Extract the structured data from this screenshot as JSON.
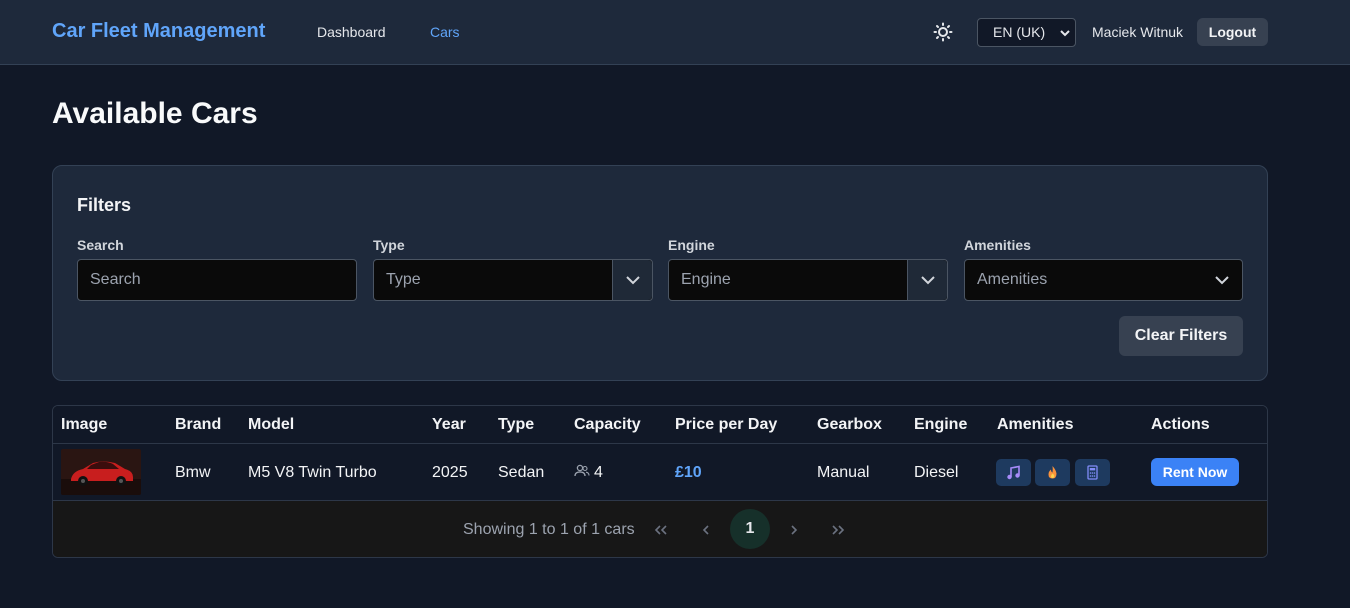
{
  "header": {
    "brand": "Car Fleet Management",
    "nav": [
      {
        "label": "Dashboard",
        "active": false
      },
      {
        "label": "Cars",
        "active": true
      }
    ],
    "theme_icon": "sun-icon",
    "language": "EN (UK)",
    "user_name": "Maciek Witnuk",
    "logout_label": "Logout"
  },
  "page_title": "Available Cars",
  "filters": {
    "title": "Filters",
    "search": {
      "label": "Search",
      "placeholder": "Search"
    },
    "type": {
      "label": "Type",
      "placeholder": "Type"
    },
    "engine": {
      "label": "Engine",
      "placeholder": "Engine"
    },
    "amenities": {
      "label": "Amenities",
      "placeholder": "Amenities"
    },
    "clear_label": "Clear Filters"
  },
  "table": {
    "columns": [
      "Image",
      "Brand",
      "Model",
      "Year",
      "Type",
      "Capacity",
      "Price per Day",
      "Gearbox",
      "Engine",
      "Amenities",
      "Actions"
    ],
    "rows": [
      {
        "brand": "Bmw",
        "model": "M5 V8 Twin Turbo",
        "year": "2025",
        "type": "Sedan",
        "capacity": "4",
        "price": "£10",
        "gearbox": "Manual",
        "engine": "Diesel",
        "amenities": [
          "music-icon",
          "flame-icon",
          "calculator-icon"
        ],
        "action_label": "Rent Now"
      }
    ]
  },
  "pagination": {
    "info": "Showing 1 to 1 of 1 cars",
    "current_page": "1"
  },
  "colors": {
    "accent": "#60a5fa",
    "button_primary": "#3b82f6",
    "background": "#111827",
    "panel": "#1e293b"
  }
}
